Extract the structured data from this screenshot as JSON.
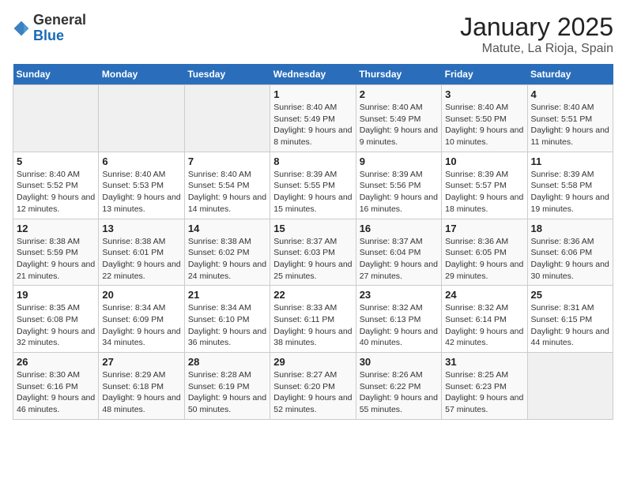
{
  "logo": {
    "general": "General",
    "blue": "Blue"
  },
  "header": {
    "month": "January 2025",
    "location": "Matute, La Rioja, Spain"
  },
  "days_of_week": [
    "Sunday",
    "Monday",
    "Tuesday",
    "Wednesday",
    "Thursday",
    "Friday",
    "Saturday"
  ],
  "weeks": [
    [
      {
        "day": "",
        "info": ""
      },
      {
        "day": "",
        "info": ""
      },
      {
        "day": "",
        "info": ""
      },
      {
        "day": "1",
        "info": "Sunrise: 8:40 AM\nSunset: 5:49 PM\nDaylight: 9 hours and 8 minutes."
      },
      {
        "day": "2",
        "info": "Sunrise: 8:40 AM\nSunset: 5:49 PM\nDaylight: 9 hours and 9 minutes."
      },
      {
        "day": "3",
        "info": "Sunrise: 8:40 AM\nSunset: 5:50 PM\nDaylight: 9 hours and 10 minutes."
      },
      {
        "day": "4",
        "info": "Sunrise: 8:40 AM\nSunset: 5:51 PM\nDaylight: 9 hours and 11 minutes."
      }
    ],
    [
      {
        "day": "5",
        "info": "Sunrise: 8:40 AM\nSunset: 5:52 PM\nDaylight: 9 hours and 12 minutes."
      },
      {
        "day": "6",
        "info": "Sunrise: 8:40 AM\nSunset: 5:53 PM\nDaylight: 9 hours and 13 minutes."
      },
      {
        "day": "7",
        "info": "Sunrise: 8:40 AM\nSunset: 5:54 PM\nDaylight: 9 hours and 14 minutes."
      },
      {
        "day": "8",
        "info": "Sunrise: 8:39 AM\nSunset: 5:55 PM\nDaylight: 9 hours and 15 minutes."
      },
      {
        "day": "9",
        "info": "Sunrise: 8:39 AM\nSunset: 5:56 PM\nDaylight: 9 hours and 16 minutes."
      },
      {
        "day": "10",
        "info": "Sunrise: 8:39 AM\nSunset: 5:57 PM\nDaylight: 9 hours and 18 minutes."
      },
      {
        "day": "11",
        "info": "Sunrise: 8:39 AM\nSunset: 5:58 PM\nDaylight: 9 hours and 19 minutes."
      }
    ],
    [
      {
        "day": "12",
        "info": "Sunrise: 8:38 AM\nSunset: 5:59 PM\nDaylight: 9 hours and 21 minutes."
      },
      {
        "day": "13",
        "info": "Sunrise: 8:38 AM\nSunset: 6:01 PM\nDaylight: 9 hours and 22 minutes."
      },
      {
        "day": "14",
        "info": "Sunrise: 8:38 AM\nSunset: 6:02 PM\nDaylight: 9 hours and 24 minutes."
      },
      {
        "day": "15",
        "info": "Sunrise: 8:37 AM\nSunset: 6:03 PM\nDaylight: 9 hours and 25 minutes."
      },
      {
        "day": "16",
        "info": "Sunrise: 8:37 AM\nSunset: 6:04 PM\nDaylight: 9 hours and 27 minutes."
      },
      {
        "day": "17",
        "info": "Sunrise: 8:36 AM\nSunset: 6:05 PM\nDaylight: 9 hours and 29 minutes."
      },
      {
        "day": "18",
        "info": "Sunrise: 8:36 AM\nSunset: 6:06 PM\nDaylight: 9 hours and 30 minutes."
      }
    ],
    [
      {
        "day": "19",
        "info": "Sunrise: 8:35 AM\nSunset: 6:08 PM\nDaylight: 9 hours and 32 minutes."
      },
      {
        "day": "20",
        "info": "Sunrise: 8:34 AM\nSunset: 6:09 PM\nDaylight: 9 hours and 34 minutes."
      },
      {
        "day": "21",
        "info": "Sunrise: 8:34 AM\nSunset: 6:10 PM\nDaylight: 9 hours and 36 minutes."
      },
      {
        "day": "22",
        "info": "Sunrise: 8:33 AM\nSunset: 6:11 PM\nDaylight: 9 hours and 38 minutes."
      },
      {
        "day": "23",
        "info": "Sunrise: 8:32 AM\nSunset: 6:13 PM\nDaylight: 9 hours and 40 minutes."
      },
      {
        "day": "24",
        "info": "Sunrise: 8:32 AM\nSunset: 6:14 PM\nDaylight: 9 hours and 42 minutes."
      },
      {
        "day": "25",
        "info": "Sunrise: 8:31 AM\nSunset: 6:15 PM\nDaylight: 9 hours and 44 minutes."
      }
    ],
    [
      {
        "day": "26",
        "info": "Sunrise: 8:30 AM\nSunset: 6:16 PM\nDaylight: 9 hours and 46 minutes."
      },
      {
        "day": "27",
        "info": "Sunrise: 8:29 AM\nSunset: 6:18 PM\nDaylight: 9 hours and 48 minutes."
      },
      {
        "day": "28",
        "info": "Sunrise: 8:28 AM\nSunset: 6:19 PM\nDaylight: 9 hours and 50 minutes."
      },
      {
        "day": "29",
        "info": "Sunrise: 8:27 AM\nSunset: 6:20 PM\nDaylight: 9 hours and 52 minutes."
      },
      {
        "day": "30",
        "info": "Sunrise: 8:26 AM\nSunset: 6:22 PM\nDaylight: 9 hours and 55 minutes."
      },
      {
        "day": "31",
        "info": "Sunrise: 8:25 AM\nSunset: 6:23 PM\nDaylight: 9 hours and 57 minutes."
      },
      {
        "day": "",
        "info": ""
      }
    ]
  ]
}
